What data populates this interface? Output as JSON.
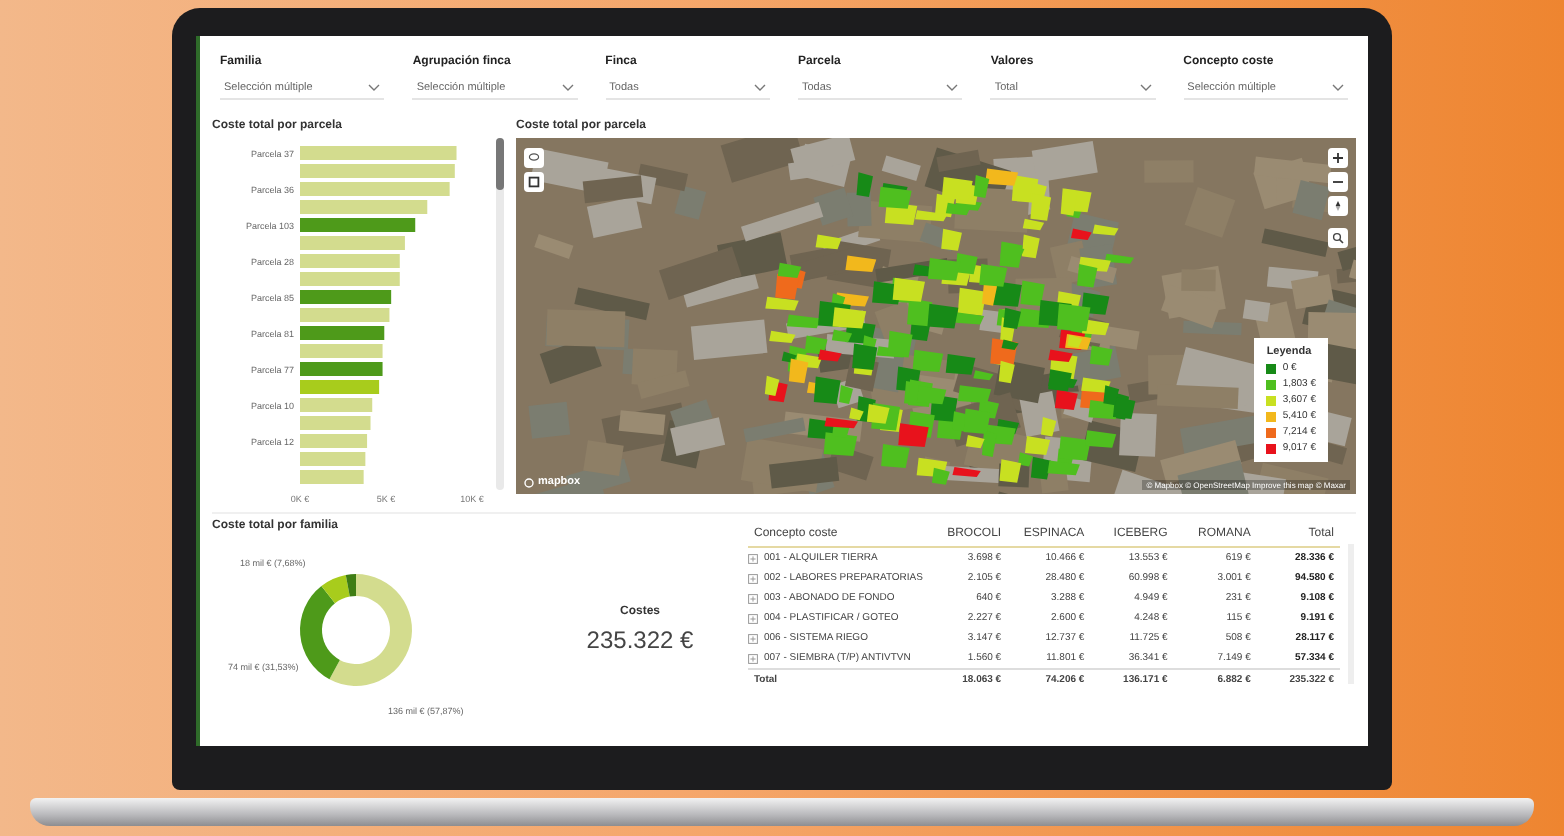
{
  "filters": [
    {
      "label": "Familia",
      "value": "Selección múltiple"
    },
    {
      "label": "Agrupación finca",
      "value": "Selección múltiple"
    },
    {
      "label": "Finca",
      "value": "Todas"
    },
    {
      "label": "Parcela",
      "value": "Todas"
    },
    {
      "label": "Valores",
      "value": "Total"
    },
    {
      "label": "Concepto coste",
      "value": "Selección múltiple"
    }
  ],
  "bar_panel": {
    "title": "Coste total por parcela",
    "chart_data": {
      "type": "bar",
      "orientation": "horizontal",
      "categories": [
        "Parcela 37",
        null,
        "Parcela 36",
        null,
        "Parcela 103",
        null,
        "Parcela 28",
        null,
        "Parcela 85",
        null,
        "Parcela 81",
        null,
        "Parcela 77",
        null,
        "Parcela 10",
        null,
        "Parcela 12",
        null,
        null
      ],
      "values": [
        9.1,
        9.0,
        8.7,
        7.4,
        6.7,
        6.1,
        5.8,
        5.8,
        5.3,
        5.2,
        4.9,
        4.8,
        4.8,
        4.6,
        4.2,
        4.1,
        3.9,
        3.8,
        3.7
      ],
      "colors": [
        "#d3dc8e",
        "#d3dc8e",
        "#d3dc8e",
        "#d3dc8e",
        "#4e9a1a",
        "#d3dc8e",
        "#d3dc8e",
        "#d3dc8e",
        "#4e9a1a",
        "#d3dc8e",
        "#4e9a1a",
        "#d3dc8e",
        "#4e9a1a",
        "#a8cc1c",
        "#d3dc8e",
        "#d3dc8e",
        "#d3dc8e",
        "#d3dc8e",
        "#d3dc8e"
      ],
      "xlim": [
        0,
        10
      ],
      "xticks": [
        {
          "value": 0,
          "label": "0K €"
        },
        {
          "value": 5,
          "label": "5K €"
        },
        {
          "value": 10,
          "label": "10K €"
        }
      ]
    }
  },
  "map_panel": {
    "title": "Coste total por parcela",
    "logo_text": "mapbox",
    "attribution": "© Mapbox © OpenStreetMap Improve this map © Maxar",
    "legend": {
      "title": "Leyenda",
      "items": [
        {
          "label": "0 €",
          "color": "#178a17"
        },
        {
          "label": "1,803 €",
          "color": "#4fbf1f"
        },
        {
          "label": "3,607 €",
          "color": "#c8e021"
        },
        {
          "label": "5,410 €",
          "color": "#f2b81c"
        },
        {
          "label": "7,214 €",
          "color": "#ef6a1c"
        },
        {
          "label": "9,017 €",
          "color": "#e8121c"
        }
      ]
    }
  },
  "family_panel": {
    "title": "Coste total por familia",
    "chart_data": {
      "type": "donut",
      "values": [
        136.171,
        74.206,
        18.063,
        6.882
      ],
      "colors": [
        "#d3dc8e",
        "#4e9a1a",
        "#a8cc1c",
        "#3e7d14"
      ],
      "value_labels": [
        "136 mil € (57,87%)",
        "74 mil € (31,53%)",
        "18 mil € (7,68%)",
        null
      ]
    }
  },
  "kpi": {
    "label": "Costes",
    "value": "235.322 €"
  },
  "table": {
    "columns": [
      "Concepto coste",
      "BROCOLI",
      "ESPINACA",
      "ICEBERG",
      "ROMANA",
      "Total"
    ],
    "rows": [
      {
        "cells": [
          "001 - ALQUILER TIERRA",
          "3.698 €",
          "10.466 €",
          "13.553 €",
          "619 €",
          "28.336 €"
        ]
      },
      {
        "cells": [
          "002 - LABORES PREPARATORIAS",
          "2.105 €",
          "28.480 €",
          "60.998 €",
          "3.001 €",
          "94.580 €"
        ]
      },
      {
        "cells": [
          "003 - ABONADO DE FONDO",
          "640 €",
          "3.288 €",
          "4.949 €",
          "231 €",
          "9.108 €"
        ]
      },
      {
        "cells": [
          "004 - PLASTIFICAR / GOTEO",
          "2.227 €",
          "2.600 €",
          "4.248 €",
          "115 €",
          "9.191 €"
        ]
      },
      {
        "cells": [
          "006 - SISTEMA RIEGO",
          "3.147 €",
          "12.737 €",
          "11.725 €",
          "508 €",
          "28.117 €"
        ]
      },
      {
        "cells": [
          "007 - SIEMBRA (T/P) ANTIVTVN",
          "1.560 €",
          "11.801 €",
          "36.341 €",
          "7.149 €",
          "57.334 €"
        ]
      }
    ],
    "total": {
      "cells": [
        "Total",
        "18.063 €",
        "74.206 €",
        "136.171 €",
        "6.882 €",
        "235.322 €"
      ]
    }
  }
}
